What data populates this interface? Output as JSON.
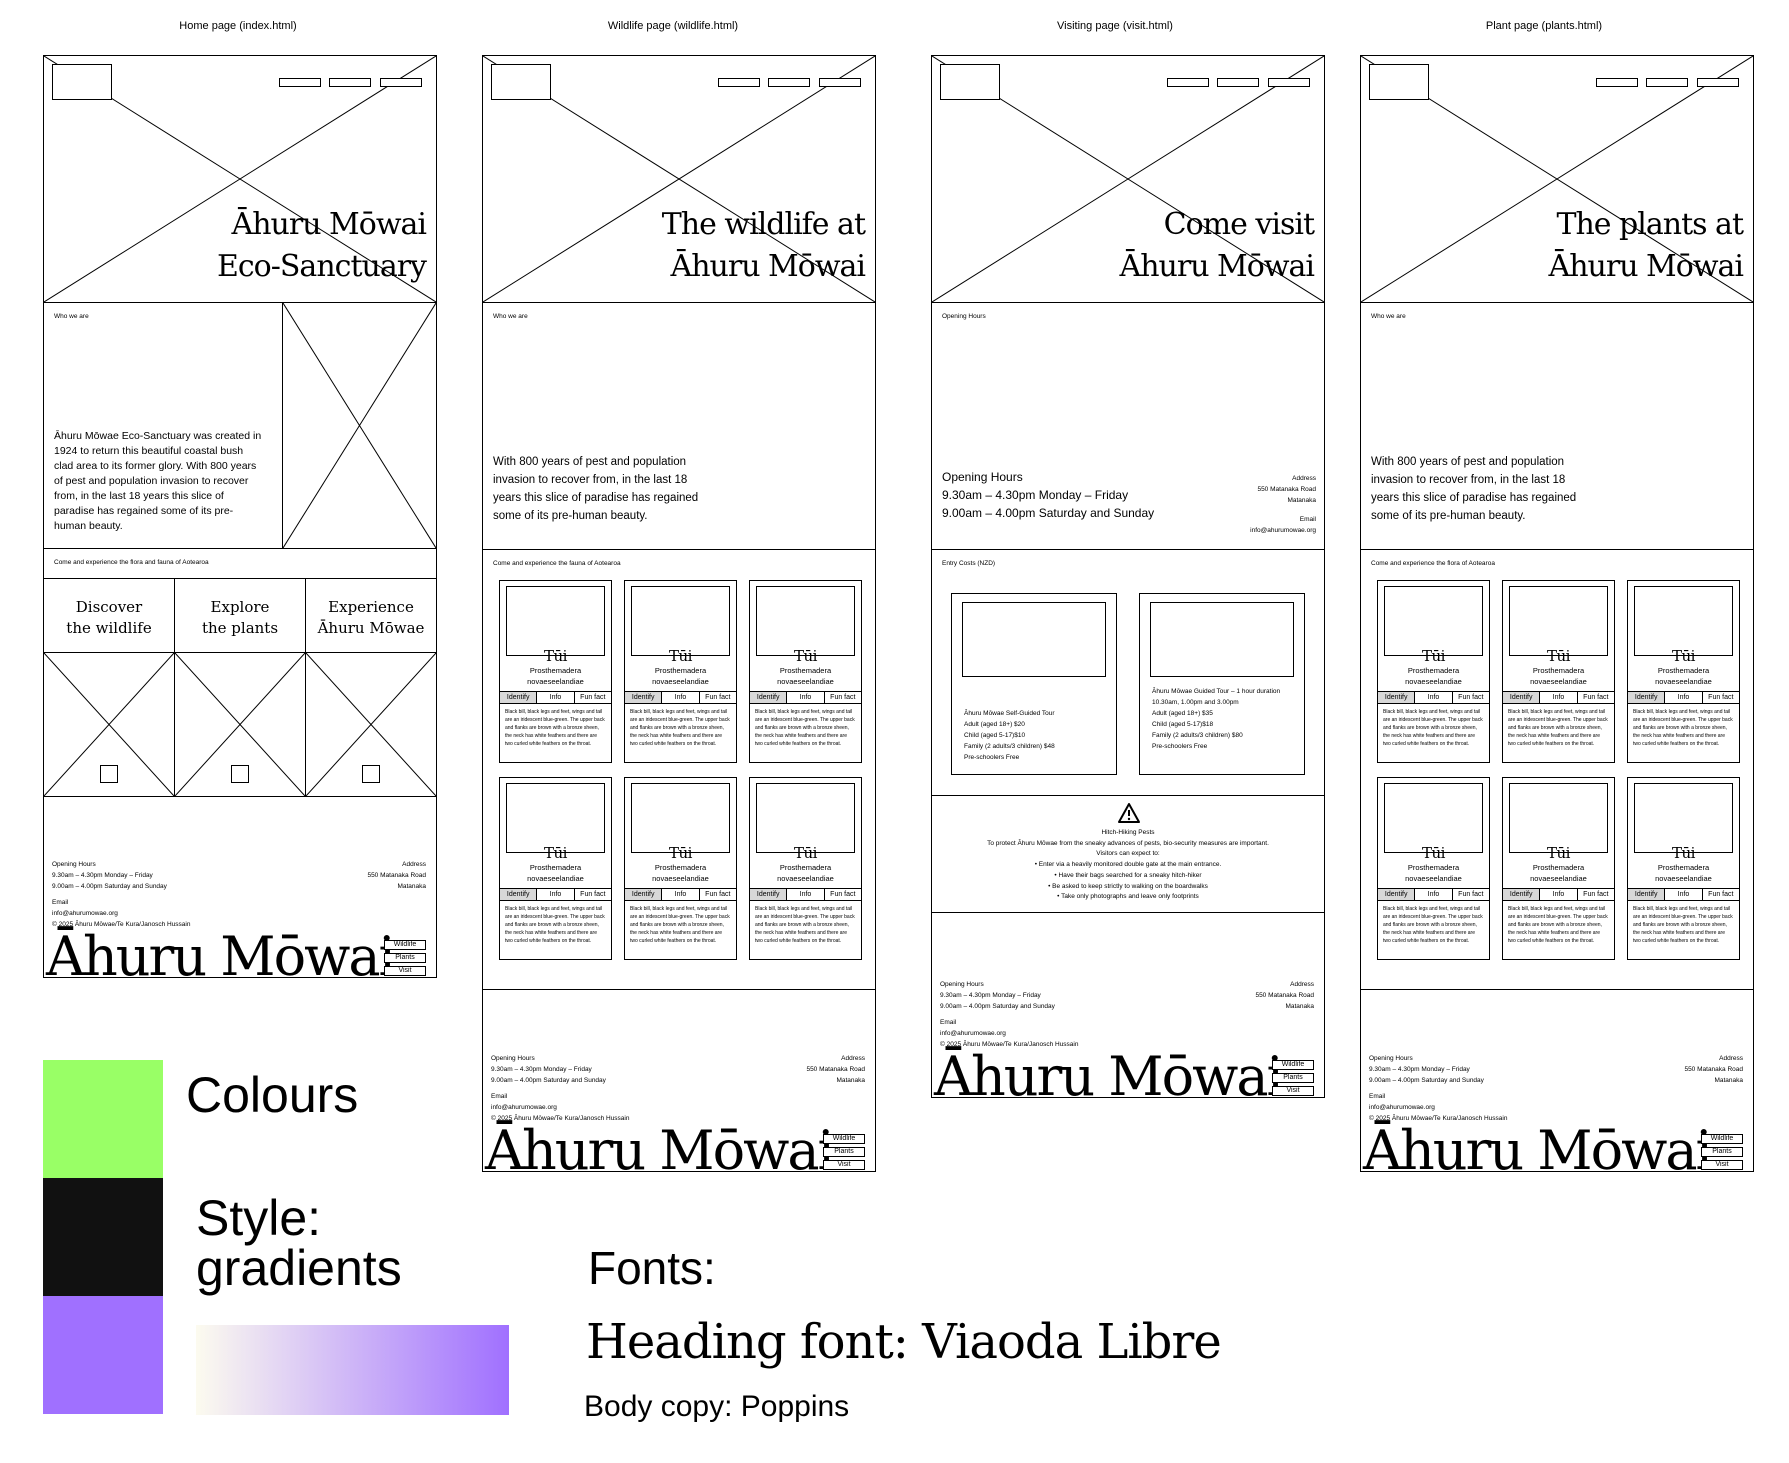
{
  "pages": {
    "home": {
      "title": "Home page (index.html)",
      "hero_title_line1": "Āhuru Mōwai",
      "hero_title_line2": "Eco-Sanctuary",
      "who_label": "Who we are",
      "who_text": "Āhuru Mōwae Eco-Sanctuary was created in 1924 to return this beautiful coastal bush clad area to its former glory. With 800 years of pest and population invasion to recover from, in the last 18 years this slice of paradise has regained some of its pre-human beauty.",
      "experience_label": "Come and experience the flora and fauna of Aotearoa",
      "links": [
        {
          "line1": "Discover",
          "line2": "the wildlife"
        },
        {
          "line1": "Explore",
          "line2": "the plants"
        },
        {
          "line1": "Experience",
          "line2": "Āhuru Mōwae"
        }
      ]
    },
    "wildlife": {
      "title": "Wildlife page (wildlife.html)",
      "hero_title_line1": "The wildlife at",
      "hero_title_line2": "Āhuru Mōwai",
      "who_label": "Who we are",
      "who_text": "With 800 years of pest and population invasion to recover from, in the last 18 years this slice of paradise has regained some of its pre-human beauty.",
      "grid_label": "Come and experience the fauna of Aotearoa"
    },
    "visit": {
      "title": "Visiting page (visit.html)",
      "hero_title_line1": "Come visit",
      "hero_title_line2": "Āhuru Mōwai",
      "hours_label": "Opening Hours",
      "hours_title": "Opening Hours",
      "hours_line1": "9.30am – 4.30pm Monday – Friday",
      "hours_line2": "9.00am – 4.00pm Saturday and Sunday",
      "address_label": "Address",
      "address_line1": "550 Matanaka Road",
      "address_line2": "Matanaka",
      "email_label": "Email",
      "email": "info@ahurumowae.org",
      "costs_label": "Entry Costs (NZD)",
      "tour1": [
        "Āhuru Mōwae Self-Guided Tour",
        "Adult (aged 18+) $20",
        "Child (aged 5-17)$10",
        "Family (2 adults/3 children) $48",
        "Pre-schoolers Free"
      ],
      "tour2": [
        "Āhuru Mōwae Guided Tour – 1 hour duration",
        "10.30am, 1.00pm and 3.00pm",
        "Adult (aged 18+) $35",
        "Child (aged 5-17)$18",
        "Family (2 adults/3 children) $80",
        "Pre-schoolers Free"
      ],
      "pests_title": "Hitch-Hiking Pests",
      "pests_intro": "To protect Āhuru Mōwae from the sneaky advances of pests, bio-security measures are important.",
      "pests_expect": "Visitors can expect to:",
      "pests_items": [
        "• Enter via a heavily monitored double gate at the main entrance.",
        "• Have their bags searched for a sneaky hitch-hiker",
        "• Be asked to keep strictly to walking on the boardwalks",
        "• Take only photographs and leave only footprints"
      ]
    },
    "plants": {
      "title": "Plant page (plants.html)",
      "hero_title_line1": "The plants at",
      "hero_title_line2": "Āhuru Mōwai",
      "who_label": "Who we are",
      "who_text": "With 800 years of pest and population invasion to recover from, in the last 18 years this slice of paradise has regained some of its pre-human beauty.",
      "grid_label": "Come and experience the flora of Aotearoa"
    }
  },
  "card": {
    "name": "Tūi",
    "latin_line1": "Prosthemadera",
    "latin_line2": "novaeseelandiae",
    "tabs": [
      "Identify",
      "Info",
      "Fun fact"
    ],
    "desc": "Black bill, black legs and feet, wings and tail are an iridescent blue-green. The upper back and flanks are brown with a bronze sheen, the neck has white feathers and there are two curled white feathers on the throat."
  },
  "footer": {
    "hours_label": "Opening Hours",
    "hours_line1": "9.30am – 4.30pm Monday – Friday",
    "hours_line2": "9.00am – 4.00pm Saturday and Sunday",
    "address_label": "Address",
    "address_line1": "550 Matanaka Road",
    "address_line2": "Matanaka",
    "email_label": "Email",
    "email": "info@ahurumowae.org",
    "copyright": "© 2025 Āhuru Mōwae/Te Kura/Janosch Hussain",
    "brand": "Āhuru Mōwai",
    "buttons": [
      "Wildlife",
      "Plants",
      "Visit"
    ]
  },
  "style_guide": {
    "colours_label": "Colours",
    "colours": [
      "#99ff66",
      "#111111",
      "#a070ff"
    ],
    "style_label": "Style: gradients",
    "gradient_from": "#fcfbef",
    "gradient_to": "#a070ff",
    "fonts_label": "Fonts:",
    "heading_font": "Heading font: Viaoda Libre",
    "body_font": "Body copy: Poppins"
  }
}
